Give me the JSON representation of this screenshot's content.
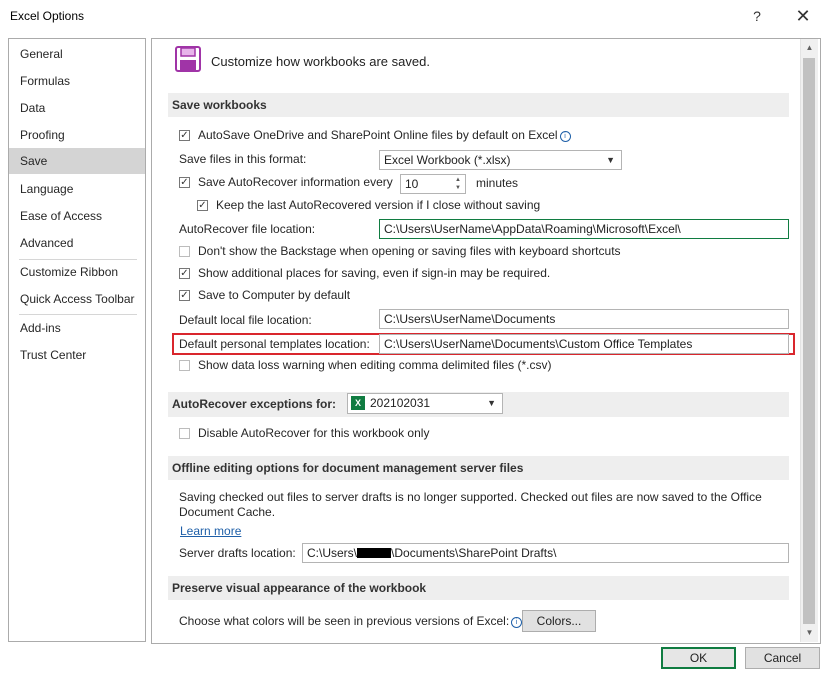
{
  "window": {
    "title": "Excel Options",
    "help_icon": "?",
    "close_icon": "✕"
  },
  "sidebar": {
    "items": [
      {
        "label": "General"
      },
      {
        "label": "Formulas"
      },
      {
        "label": "Data"
      },
      {
        "label": "Proofing"
      },
      {
        "label": "Save",
        "active": true
      },
      {
        "label": "Language"
      },
      {
        "label": "Ease of Access"
      },
      {
        "label": "Advanced"
      },
      {
        "label": "Customize Ribbon"
      },
      {
        "label": "Quick Access Toolbar"
      },
      {
        "label": "Add-ins"
      },
      {
        "label": "Trust Center"
      }
    ]
  },
  "header": {
    "text": "Customize how workbooks are saved."
  },
  "save_workbooks": {
    "title": "Save workbooks",
    "autosave_label": "AutoSave OneDrive and SharePoint Online files by default on Excel",
    "autosave_checked": true,
    "format_label": "Save files in this format:",
    "format_value": "Excel Workbook (*.xlsx)",
    "autorecover_label": "Save AutoRecover information every",
    "autorecover_checked": true,
    "autorecover_minutes": "10",
    "minutes_label": "minutes",
    "keep_last_label": "Keep the last AutoRecovered version if I close without saving",
    "keep_last_checked": true,
    "ar_location_label": "AutoRecover file location:",
    "ar_location_value": "C:\\Users\\UserName\\AppData\\Roaming\\Microsoft\\Excel\\",
    "backstage_label": "Don't show the Backstage when opening or saving files with keyboard shortcuts",
    "backstage_checked": false,
    "additional_places_label": "Show additional places for saving, even if sign-in may be required.",
    "additional_places_checked": true,
    "save_to_computer_label": "Save to Computer by default",
    "save_to_computer_checked": true,
    "default_local_label": "Default local file location:",
    "default_local_value": "C:\\Users\\UserName\\Documents",
    "templates_label": "Default personal templates location:",
    "templates_value": "C:\\Users\\UserName\\Documents\\Custom Office Templates",
    "data_loss_label": "Show data loss warning when editing comma delimited files (*.csv)",
    "data_loss_checked": false
  },
  "ar_exceptions": {
    "title": "AutoRecover exceptions for:",
    "workbook": "202102031",
    "disable_label": "Disable AutoRecover for this workbook only",
    "disable_checked": false
  },
  "offline": {
    "title": "Offline editing options for document management server files",
    "desc_line1": "Saving checked out files to server drafts is no longer supported. Checked out files are now saved to the Office",
    "desc_line2": "Document Cache.",
    "learn_more": "Learn more",
    "drafts_label": "Server drafts location:",
    "drafts_prefix": "C:\\Users\\",
    "drafts_suffix": "\\Documents\\SharePoint Drafts\\"
  },
  "preserve": {
    "title": "Preserve visual appearance of the workbook",
    "colors_label": "Choose what colors will be seen in previous versions of Excel:",
    "colors_button": "Colors..."
  },
  "footer": {
    "ok": "OK",
    "cancel": "Cancel"
  }
}
